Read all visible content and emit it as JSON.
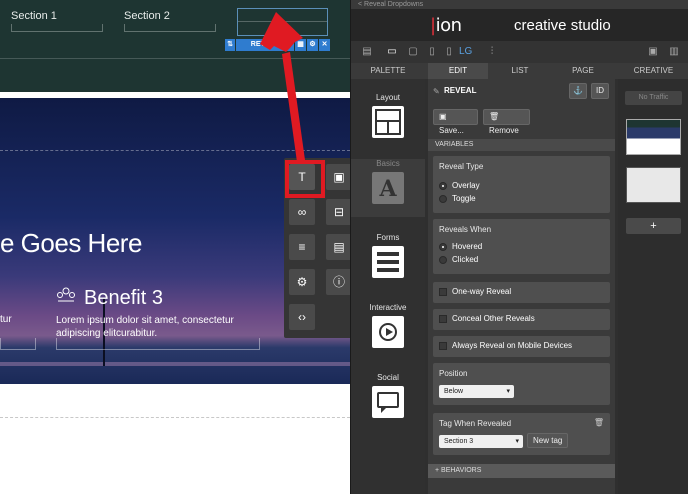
{
  "window": {
    "breadcrumb": "< Reveal Dropdowns"
  },
  "brand": {
    "logo": "ion",
    "subtitle": "creative studio"
  },
  "canvas": {
    "nav": [
      "Section 1",
      "Section 2"
    ],
    "reveal_toolbar_label": "REVEAL",
    "headline": "e Goes Here",
    "benefit_title": "Benefit 3",
    "benefit_body": "Lorem ipsum dolor sit amet, consectetur adipiscing elitcurabitur.",
    "left_fragment": "tur"
  },
  "tabs": [
    "PALETTE",
    "EDIT",
    "LIST",
    "PAGE",
    "CREATIVE"
  ],
  "toolbar": {
    "breakpoint_label": "LG"
  },
  "palette": {
    "sections": [
      {
        "label": "Layout",
        "icon": "layout-icon"
      },
      {
        "label": "Basics",
        "icon": "text-block-icon"
      },
      {
        "label": "Forms",
        "icon": "form-icon"
      },
      {
        "label": "Interactive",
        "icon": "video-play-icon"
      },
      {
        "label": "Social",
        "icon": "comment-icon"
      }
    ]
  },
  "picker": {
    "items": [
      "text-icon",
      "image-icon",
      "link-icon",
      "gallery-icon",
      "list-icon",
      "table-icon",
      "gear-icon",
      "info-icon",
      "code-icon"
    ]
  },
  "edit": {
    "element_name": "REVEAL",
    "id_label": "ID",
    "save_label": "Save...",
    "remove_label": "Remove",
    "variables_label": "VARIABLES",
    "reveal_type": {
      "title": "Reveal Type",
      "options": [
        "Overlay",
        "Toggle"
      ],
      "selected": "Overlay"
    },
    "reveals_when": {
      "title": "Reveals When",
      "options": [
        "Hovered",
        "Clicked"
      ],
      "selected": "Hovered"
    },
    "checkboxes": [
      "One-way Reveal",
      "Conceal Other Reveals",
      "Always Reveal on Mobile Devices"
    ],
    "position": {
      "title": "Position",
      "value": "Below"
    },
    "tag": {
      "title": "Tag When Revealed",
      "value": "Section 3",
      "new_tag_label": "New tag"
    },
    "behaviors_label": "+ BEHAVIORS"
  },
  "page": {
    "no_traffic": "No Traffic",
    "add_label": "+"
  },
  "colors": {
    "accent_red": "#e01a22",
    "selection_blue": "#2f7ccf",
    "header_bg": "#1e3532"
  }
}
